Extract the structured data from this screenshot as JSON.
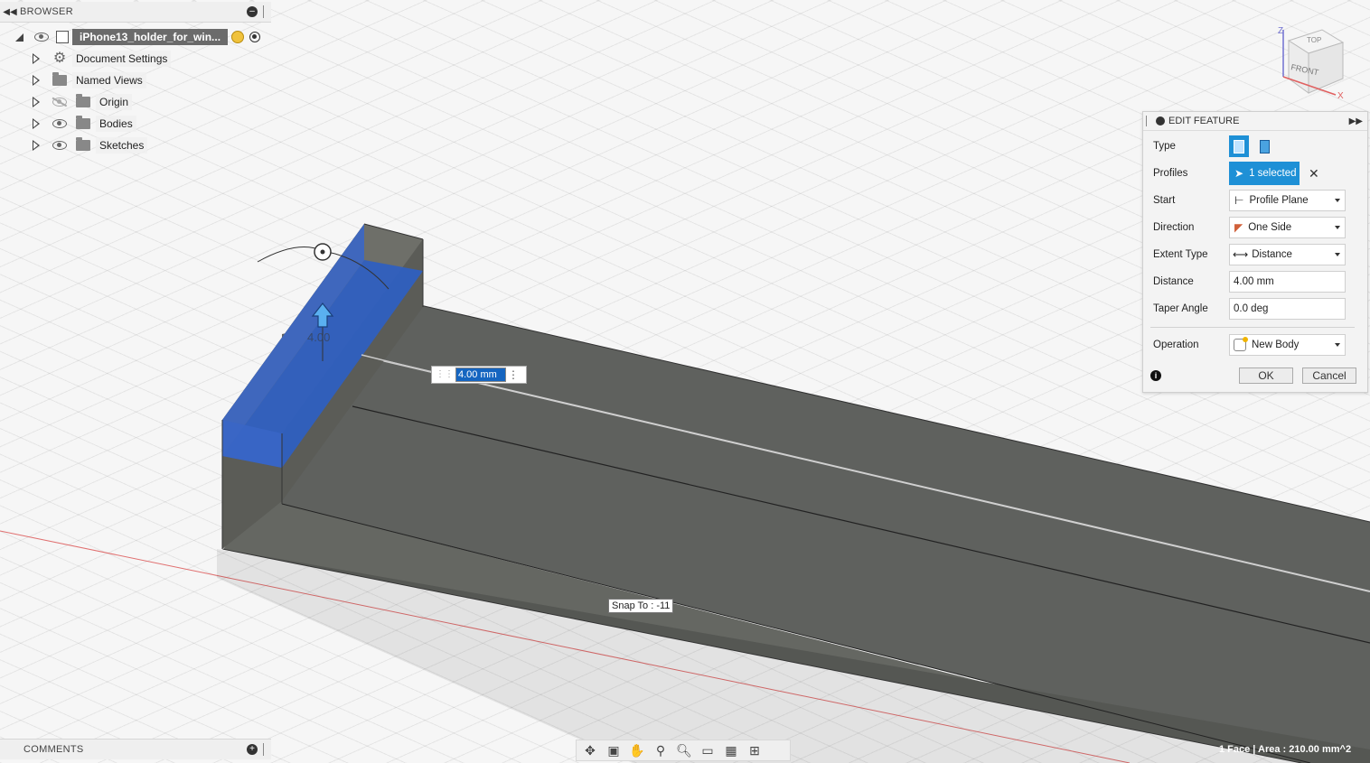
{
  "browser": {
    "title": "BROWSER",
    "document_name": "iPhone13_holder_for_win...",
    "items": [
      {
        "label": "Document Settings",
        "icon": "gear-icon"
      },
      {
        "label": "Named Views",
        "icon": "folder-icon"
      },
      {
        "label": "Origin",
        "icon": "folder-icon",
        "visible": false
      },
      {
        "label": "Bodies",
        "icon": "folder-icon",
        "visible": true
      },
      {
        "label": "Sketches",
        "icon": "folder-icon",
        "visible": true
      }
    ]
  },
  "comments": {
    "title": "COMMENTS"
  },
  "view_cube": {
    "top": "TOP",
    "front": "FRONT",
    "axis_z": "Z",
    "axis_x": "X"
  },
  "edit_feature": {
    "title": "EDIT FEATURE",
    "type_label": "Type",
    "profiles_label": "Profiles",
    "profiles_value": "1 selected",
    "start_label": "Start",
    "start_value": "Profile Plane",
    "direction_label": "Direction",
    "direction_value": "One Side",
    "extent_label": "Extent Type",
    "extent_value": "Distance",
    "distance_label": "Distance",
    "distance_value": "4.00 mm",
    "taper_label": "Taper Angle",
    "taper_value": "0.0 deg",
    "operation_label": "Operation",
    "operation_value": "New Body",
    "ok_label": "OK",
    "cancel_label": "Cancel"
  },
  "canvas": {
    "dimension_input": "4.00 mm",
    "dimension_ghost": "4.00",
    "snap_label": "Snap To : -11"
  },
  "status": {
    "selection": "1 Face | Area : 210.00 mm^2"
  },
  "colors": {
    "accent": "#1e90d6",
    "profile_face": "#2f5fc0",
    "body": "#5f615e"
  }
}
